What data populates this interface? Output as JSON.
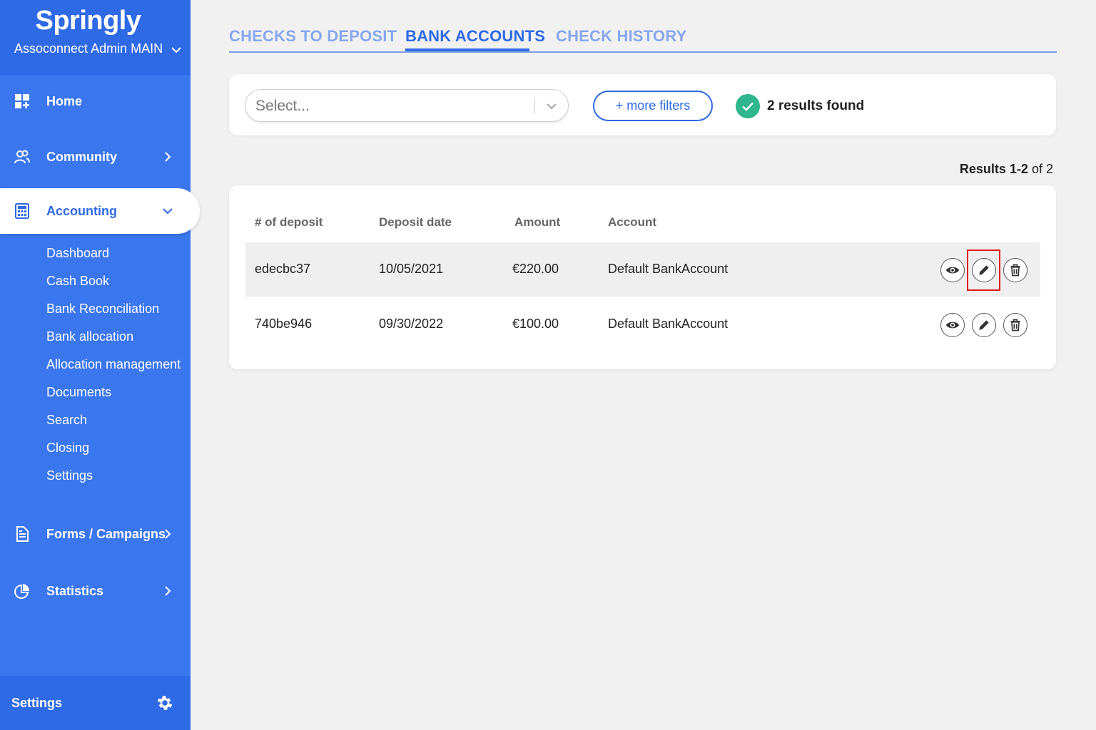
{
  "brand": {
    "name": "Springly",
    "org": "Assoconnect Admin MAIN"
  },
  "sidebar": {
    "nav": [
      {
        "label": "Home",
        "icon": "dashboard-icon"
      },
      {
        "label": "Community",
        "icon": "users-icon"
      },
      {
        "label": "Accounting",
        "icon": "calculator-icon",
        "active": true
      },
      {
        "label": "Forms / Campaigns",
        "icon": "document-icon"
      },
      {
        "label": "Statistics",
        "icon": "pie-chart-icon"
      }
    ],
    "accounting_sub": [
      "Dashboard",
      "Cash Book",
      "Bank Reconciliation",
      "Bank allocation",
      "Allocation management",
      "Documents",
      "Search",
      "Closing",
      "Settings"
    ],
    "footer_label": "Settings"
  },
  "tabs": [
    {
      "label": "CHECKS TO DEPOSIT"
    },
    {
      "label": "BANK ACCOUNTS",
      "active": true
    },
    {
      "label": "CHECK HISTORY"
    }
  ],
  "filters": {
    "select_placeholder": "Select...",
    "more_filters": "+ more filters",
    "results_found": "2 results found"
  },
  "pagination": {
    "range_label": "Results 1-2",
    "of_label": "of 2"
  },
  "table": {
    "columns": [
      "# of deposit",
      "Deposit date",
      "Amount",
      "Account"
    ],
    "rows": [
      {
        "deposit": "edecbc37",
        "date": "10/05/2021",
        "amount": "€220.00",
        "account": "Default BankAccount"
      },
      {
        "deposit": "740be946",
        "date": "09/30/2022",
        "amount": "€100.00",
        "account": "Default BankAccount"
      }
    ]
  },
  "colors": {
    "primary": "#2f6ae6",
    "sidebar": "#3a76ee",
    "success": "#2fb68e",
    "highlight": "#e01b1b"
  }
}
